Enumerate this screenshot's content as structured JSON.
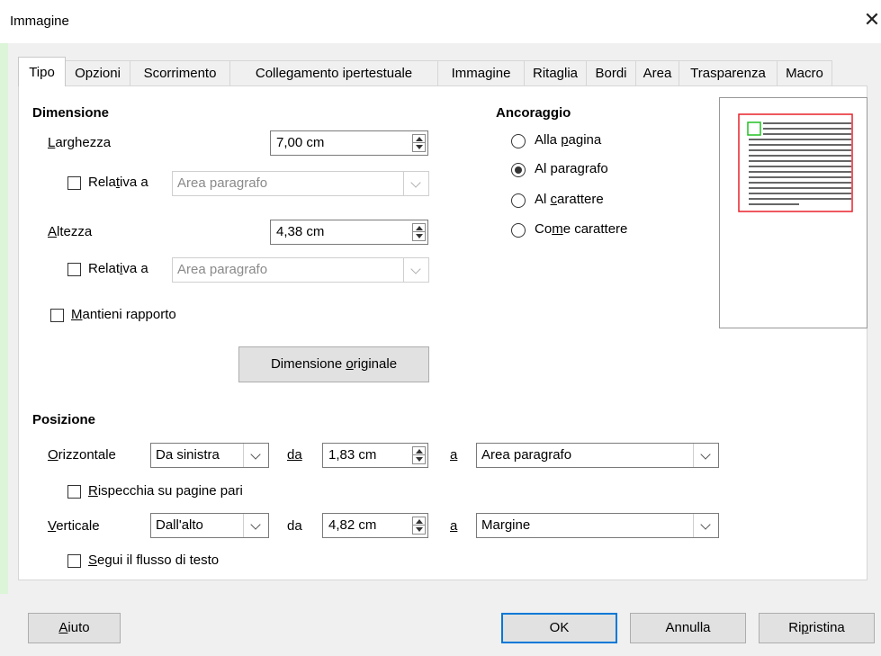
{
  "window": {
    "title": "Immagine",
    "close_icon": "close-icon"
  },
  "tabs": [
    {
      "label": "Tipo",
      "active": true
    },
    {
      "label": "Opzioni"
    },
    {
      "label": "Scorrimento"
    },
    {
      "label": "Collegamento ipertestuale"
    },
    {
      "label": "Immagine"
    },
    {
      "label": "Ritaglia"
    },
    {
      "label": "Bordi"
    },
    {
      "label": "Area"
    },
    {
      "label": "Trasparenza"
    },
    {
      "label": "Macro"
    }
  ],
  "size": {
    "heading": "Dimensione",
    "width_label": "Larghezza",
    "width_value": "7,00 cm",
    "width_relative_label": "Relativa a",
    "width_relative_value": "Area paragrafo",
    "width_relative_checked": false,
    "height_label": "Altezza",
    "height_value": "4,38 cm",
    "height_relative_label": "Relativa a",
    "height_relative_value": "Area paragrafo",
    "height_relative_checked": false,
    "keep_ratio_label": "Mantieni rapporto",
    "keep_ratio_checked": false,
    "original_size_button": "Dimensione originale"
  },
  "anchor": {
    "heading": "Ancoraggio",
    "options": [
      {
        "label": "Alla pagina",
        "checked": false
      },
      {
        "label": "Al paragrafo",
        "checked": true
      },
      {
        "label": "Al carattere",
        "checked": false
      },
      {
        "label": "Come carattere",
        "checked": false
      }
    ]
  },
  "position": {
    "heading": "Posizione",
    "horizontal_label": "Orizzontale",
    "horizontal_value": "Da sinistra",
    "horizontal_da_label": "da",
    "horizontal_offset": "1,83 cm",
    "horizontal_a_label": "a",
    "horizontal_to": "Area paragrafo",
    "mirror_label": "Rispecchia su pagine pari",
    "mirror_checked": false,
    "vertical_label": "Verticale",
    "vertical_value": "Dall'alto",
    "vertical_da_label": "da",
    "vertical_offset": "4,82 cm",
    "vertical_a_label": "a",
    "vertical_to": "Margine",
    "follow_flow_label": "Segui il flusso di testo",
    "follow_flow_checked": false
  },
  "buttons": {
    "help": "Aiuto",
    "ok": "OK",
    "cancel": "Annulla",
    "reset": "Ripristina"
  },
  "colors": {
    "accent": "#0078d7",
    "preview_frame": "#e8202a",
    "preview_anchor": "#22c022"
  }
}
